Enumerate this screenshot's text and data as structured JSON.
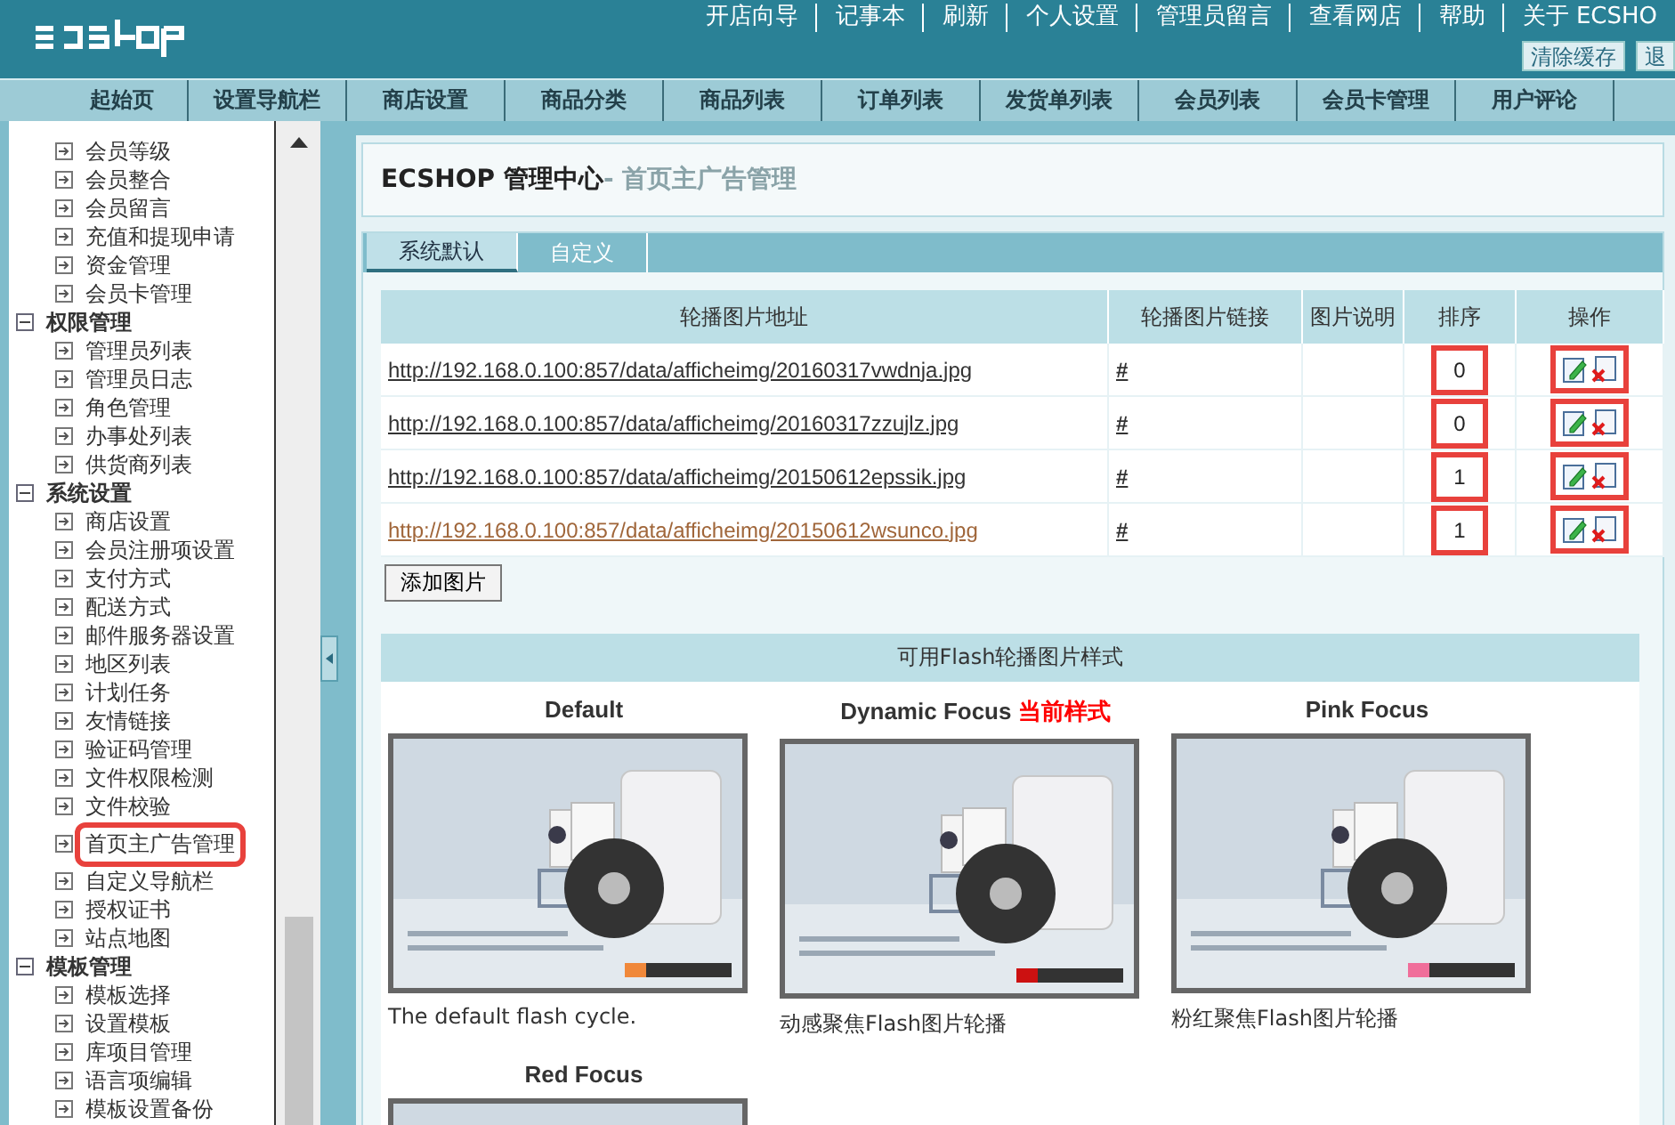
{
  "header": {
    "links": [
      "开店向导",
      "记事本",
      "刷新",
      "个人设置",
      "管理员留言",
      "查看网店",
      "帮助",
      "关于 ECSHO"
    ],
    "buttons": [
      "清除缓存",
      "退"
    ]
  },
  "nav": {
    "items": [
      "起始页",
      "设置导航栏",
      "商店设置",
      "商品分类",
      "商品列表",
      "订单列表",
      "发货单列表",
      "会员列表",
      "会员卡管理",
      "用户评论"
    ]
  },
  "sidebar": {
    "groups": [
      {
        "children": [
          {
            "label": "会员等级",
            "highlighted": false
          },
          {
            "label": "会员整合",
            "highlighted": false
          },
          {
            "label": "会员留言",
            "highlighted": false
          },
          {
            "label": "充值和提现申请",
            "highlighted": false
          },
          {
            "label": "资金管理",
            "highlighted": false
          },
          {
            "label": "会员卡管理",
            "highlighted": false
          }
        ]
      },
      {
        "label": "权限管理",
        "expanded": true,
        "children": [
          {
            "label": "管理员列表",
            "highlighted": false
          },
          {
            "label": "管理员日志",
            "highlighted": false
          },
          {
            "label": "角色管理",
            "highlighted": false
          },
          {
            "label": "办事处列表",
            "highlighted": false
          },
          {
            "label": "供货商列表",
            "highlighted": false
          }
        ]
      },
      {
        "label": "系统设置",
        "expanded": true,
        "children": [
          {
            "label": "商店设置",
            "highlighted": false
          },
          {
            "label": "会员注册项设置",
            "highlighted": false
          },
          {
            "label": "支付方式",
            "highlighted": false
          },
          {
            "label": "配送方式",
            "highlighted": false
          },
          {
            "label": "邮件服务器设置",
            "highlighted": false
          },
          {
            "label": "地区列表",
            "highlighted": false
          },
          {
            "label": "计划任务",
            "highlighted": false
          },
          {
            "label": "友情链接",
            "highlighted": false
          },
          {
            "label": "验证码管理",
            "highlighted": false
          },
          {
            "label": "文件权限检测",
            "highlighted": false
          },
          {
            "label": "文件校验",
            "highlighted": false
          },
          {
            "label": "首页主广告管理",
            "highlighted": true
          },
          {
            "label": "自定义导航栏",
            "highlighted": false
          },
          {
            "label": "授权证书",
            "highlighted": false
          },
          {
            "label": "站点地图",
            "highlighted": false
          }
        ]
      },
      {
        "label": "模板管理",
        "expanded": true,
        "children": [
          {
            "label": "模板选择",
            "highlighted": false
          },
          {
            "label": "设置模板",
            "highlighted": false
          },
          {
            "label": "库项目管理",
            "highlighted": false
          },
          {
            "label": "语言项编辑",
            "highlighted": false
          },
          {
            "label": "模板设置备份",
            "highlighted": false
          }
        ]
      }
    ]
  },
  "page_title": {
    "main": "ECSHOP 管理中心",
    "sub": "- 首页主广告管理"
  },
  "tabs": [
    {
      "label": "系统默认",
      "selected": true
    },
    {
      "label": "自定义",
      "selected": false
    }
  ],
  "table": {
    "columns": [
      "轮播图片地址",
      "轮播图片链接",
      "图片说明",
      "排序",
      "操作"
    ],
    "rows": [
      {
        "url": "http://192.168.0.100:857/data/afficheimg/20160317vwdnja.jpg",
        "link": "#",
        "sort": "0",
        "visited": false,
        "highlighted": true
      },
      {
        "url": "http://192.168.0.100:857/data/afficheimg/20160317zzujlz.jpg",
        "link": "#",
        "sort": "0",
        "visited": false,
        "highlighted": true
      },
      {
        "url": "http://192.168.0.100:857/data/afficheimg/20150612epssik.jpg",
        "link": "#",
        "sort": "1",
        "visited": false,
        "highlighted": true
      },
      {
        "url": "http://192.168.0.100:857/data/afficheimg/20150612wsunco.jpg",
        "link": "#",
        "sort": "1",
        "visited": true,
        "highlighted": true
      }
    ]
  },
  "add_button": "添加图片",
  "flash_styles": {
    "title": "可用Flash轮播图片样式",
    "current_label": "当前样式",
    "items": [
      {
        "name": "Default",
        "current": false,
        "caption": "The default flash cycle."
      },
      {
        "name": "Dynamic Focus",
        "current": true,
        "caption": "动感聚焦Flash图片轮播"
      },
      {
        "name": "Pink Focus",
        "current": false,
        "caption": "粉红聚焦Flash图片轮播"
      },
      {
        "name": "Red Focus",
        "current": false
      }
    ]
  }
}
